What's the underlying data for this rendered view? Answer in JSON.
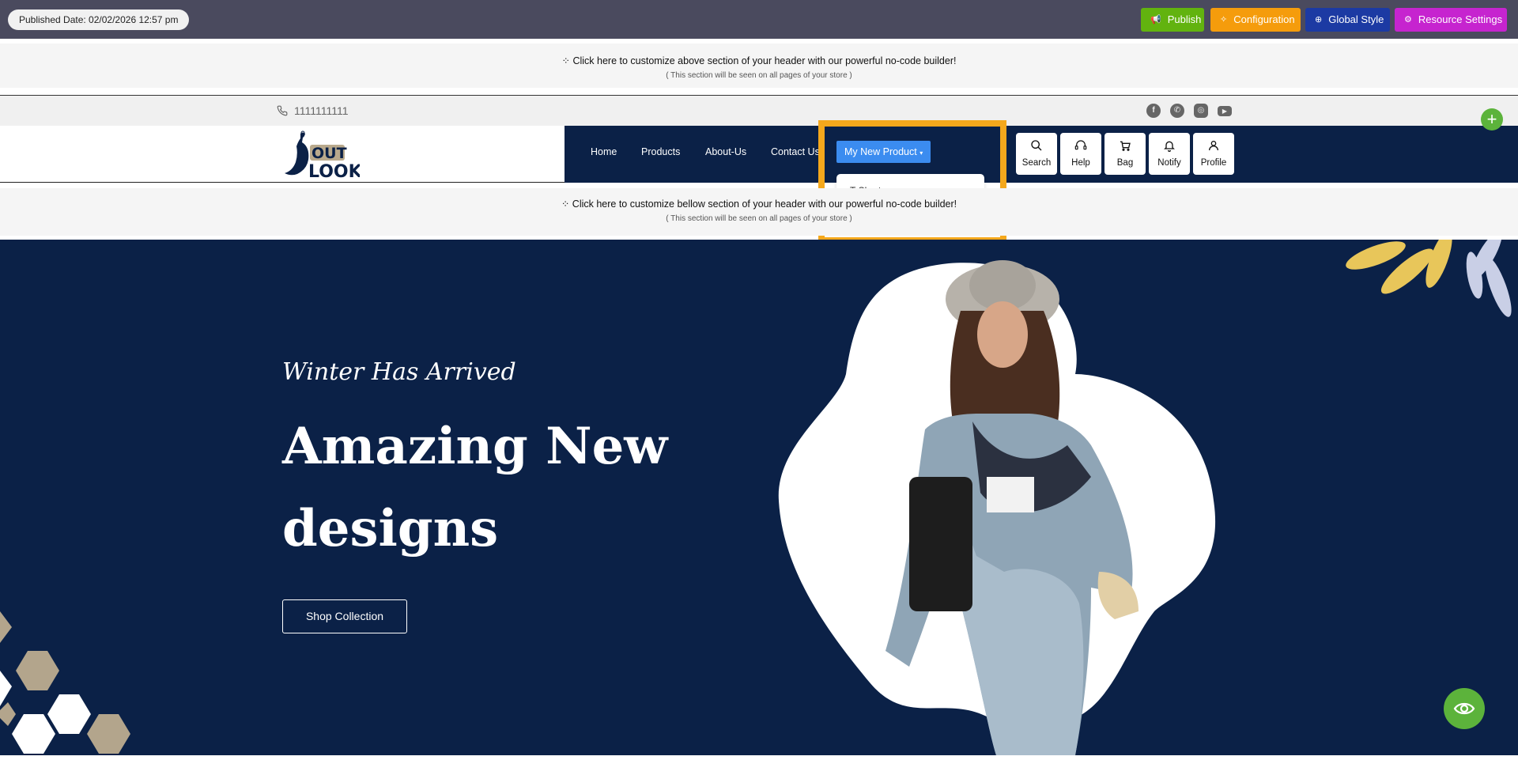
{
  "topbar": {
    "published_date": "Published Date: 02/02/2026 12:57 pm",
    "buttons": {
      "publish": "Publish",
      "configuration": "Configuration",
      "global_style": "Global Style",
      "resource_settings": "Resource Settings"
    },
    "colors": {
      "publish": "#62b30f",
      "configuration": "#f59c0c",
      "global_style": "#1c3aa3",
      "resource_settings": "#c624cf"
    }
  },
  "customize_top": {
    "text": "⁘ Click here to customize above section of your header with our powerful no-code builder!",
    "note": "( This section will be seen on all pages of your store )"
  },
  "utility": {
    "phone": "1111111111",
    "social_icons": [
      "facebook-icon",
      "whatsapp-icon",
      "instagram-icon",
      "youtube-icon"
    ]
  },
  "header": {
    "logo_text": "OUT LOOK",
    "nav": [
      "Home",
      "Products",
      "About-Us",
      "Contact Us"
    ],
    "dropdown_label": "My New Product",
    "dropdown_items": [
      "T-Shart"
    ],
    "icons": [
      {
        "label": "Search",
        "icon": "search-icon"
      },
      {
        "label": "Help",
        "icon": "headset-icon"
      },
      {
        "label": "Bag",
        "icon": "bag-icon"
      },
      {
        "label": "Notify",
        "icon": "bell-icon"
      },
      {
        "label": "Profile",
        "icon": "profile-icon"
      }
    ],
    "nav_bg": "#0b2147",
    "highlight_color": "#f5a81c"
  },
  "customize_bottom": {
    "text": "⁘ Click here to customize bellow section of your header with our powerful no-code builder!",
    "note": "( This section will be seen on all pages of your store )"
  },
  "hero": {
    "script_title": "Winter Has Arrived",
    "headline_line1": "Amazing New",
    "headline_line2": "designs",
    "cta": "Shop Collection",
    "bg": "#0b2147"
  }
}
